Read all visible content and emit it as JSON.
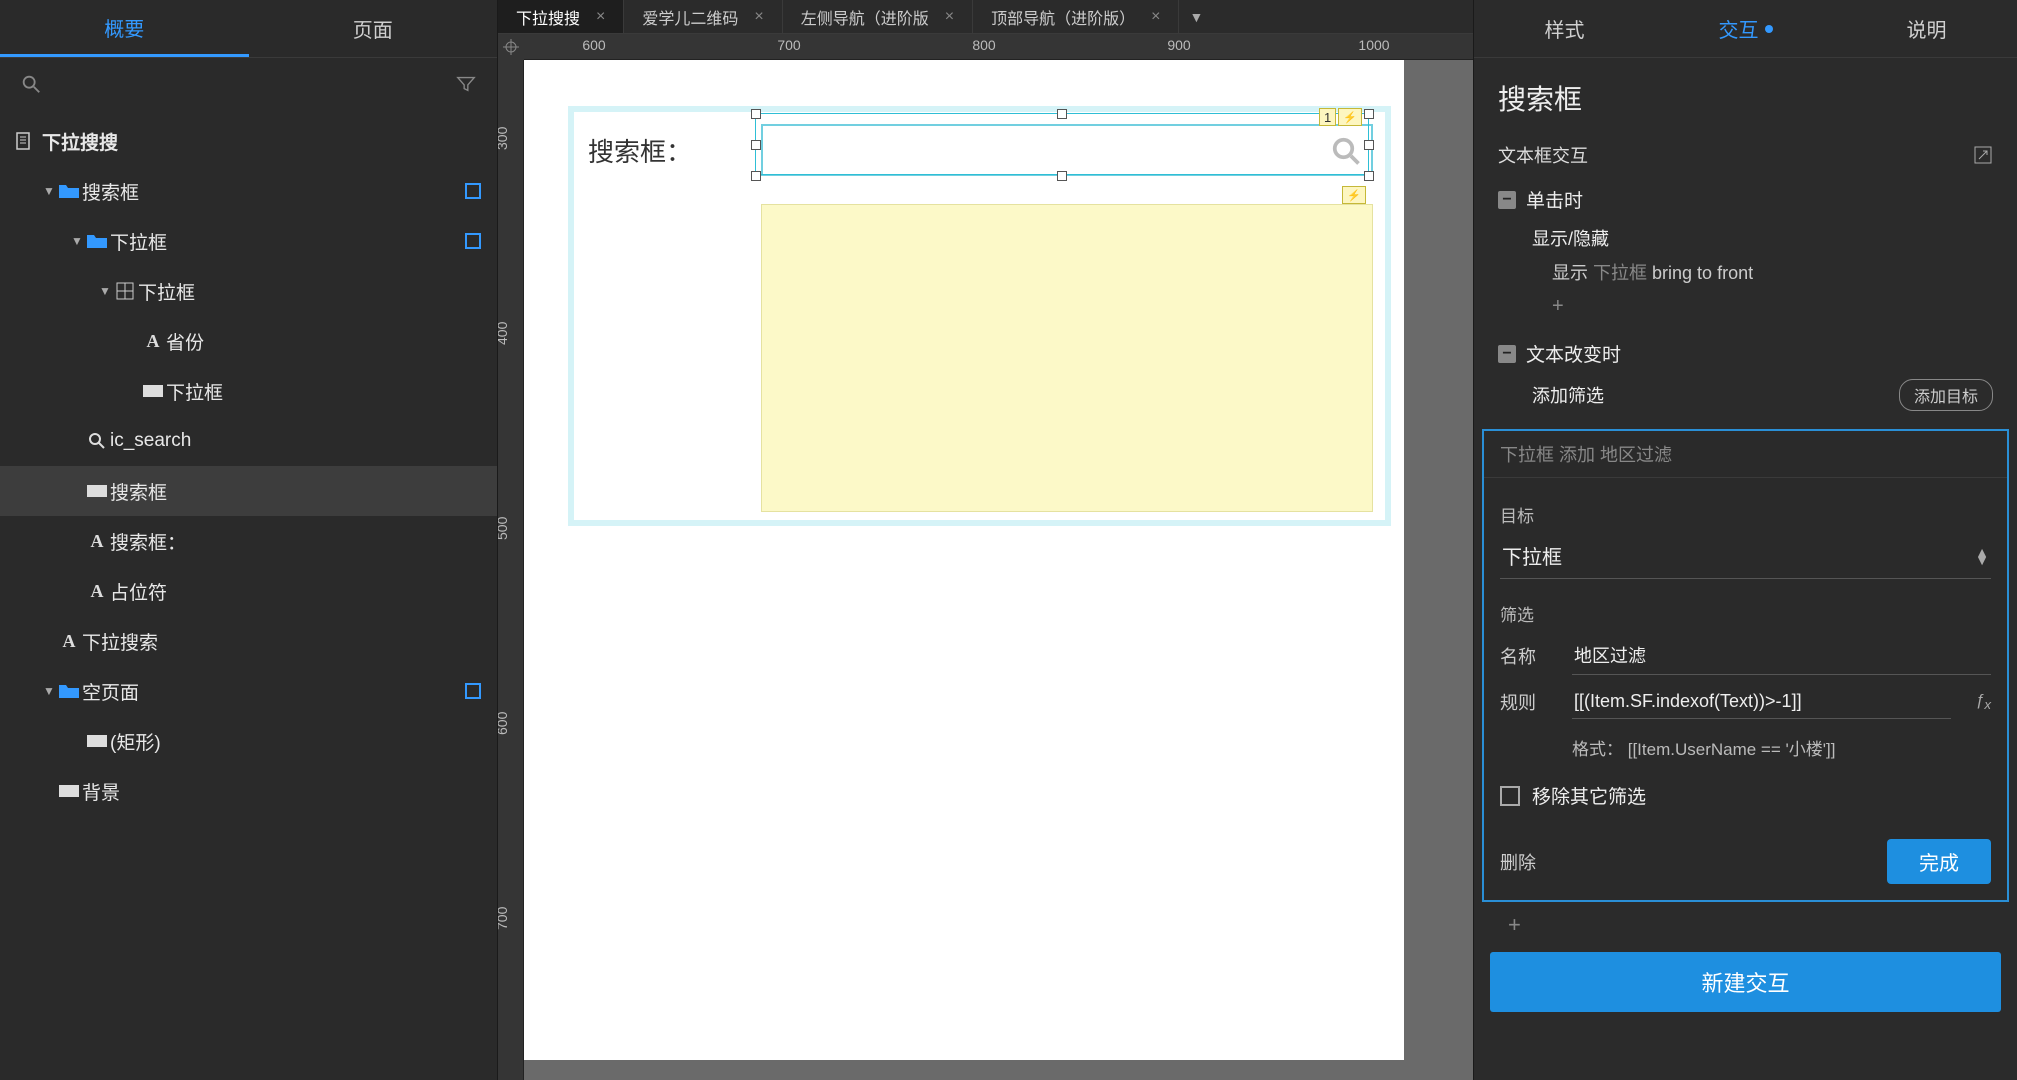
{
  "left_tabs": {
    "overview": "概要",
    "pages": "页面"
  },
  "outline": {
    "root": "下拉搜搜",
    "items": [
      {
        "label": "搜索框",
        "type": "folder",
        "depth": 1,
        "chev": "▼",
        "marker": true
      },
      {
        "label": "下拉框",
        "type": "folder",
        "depth": 2,
        "chev": "▼",
        "marker": true
      },
      {
        "label": "下拉框",
        "type": "grid",
        "depth": 3,
        "chev": "▼"
      },
      {
        "label": "省份",
        "type": "text",
        "depth": 4
      },
      {
        "label": "下拉框",
        "type": "rect",
        "depth": 4
      },
      {
        "label": "ic_search",
        "type": "search",
        "depth": 2
      },
      {
        "label": "搜索框",
        "type": "rect",
        "depth": 2,
        "selected": true
      },
      {
        "label": "搜索框：",
        "type": "text",
        "depth": 2
      },
      {
        "label": "占位符",
        "type": "text",
        "depth": 2
      },
      {
        "label": "下拉搜索",
        "type": "text",
        "depth": 1
      },
      {
        "label": "空页面",
        "type": "folder",
        "depth": 1,
        "chev": "▼",
        "marker": true
      },
      {
        "label": "(矩形)",
        "type": "rect",
        "depth": 2
      },
      {
        "label": "背景",
        "type": "rect",
        "depth": 1
      }
    ]
  },
  "doc_tabs": [
    {
      "label": "下拉搜搜",
      "active": true
    },
    {
      "label": "爱学儿二维码"
    },
    {
      "label": "左侧导航（进阶版"
    },
    {
      "label": "顶部导航（进阶版）"
    }
  ],
  "ruler_h": [
    600,
    700,
    800,
    900,
    1000
  ],
  "ruler_v": [
    300,
    400,
    500,
    600,
    700
  ],
  "canvas": {
    "search_label": "搜索框：",
    "badge_num": "1"
  },
  "right": {
    "tabs": {
      "style": "样式",
      "interact": "交互",
      "notes": "说明"
    },
    "title": "搜索框",
    "section": "文本框交互",
    "event_click": "单击时",
    "action_showhide": "显示/隐藏",
    "action_show": "显示",
    "action_target_dim": "下拉框",
    "action_suffix": "bring to front",
    "event_textchange": "文本改变时",
    "action_addfilter": "添加筛选",
    "btn_add_target": "添加目标",
    "config_desc": "下拉框 添加 地区过滤",
    "field_target": "目标",
    "target_value": "下拉框",
    "field_filter": "筛选",
    "name_label": "名称",
    "name_value": "地区过滤",
    "rule_label": "规则",
    "rule_value": "[[(Item.SF.indexof(Text))>-1]]",
    "format_label": "格式：",
    "format_value": "[[Item.UserName == '小楼']]",
    "remove_other": "移除其它筛选",
    "delete": "删除",
    "done": "完成",
    "new_interaction": "新建交互"
  }
}
